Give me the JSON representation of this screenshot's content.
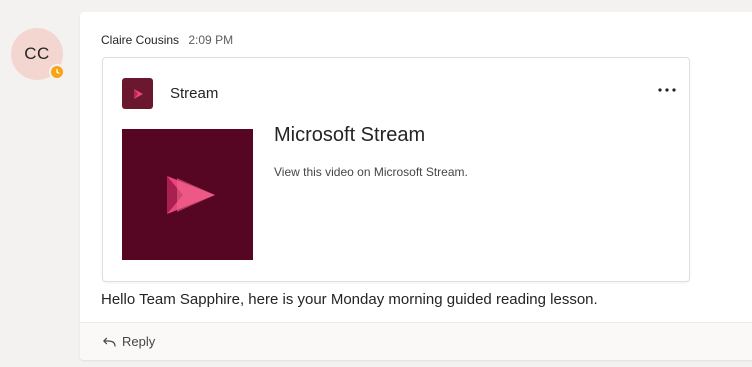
{
  "avatar": {
    "initials": "CC",
    "presence_status": "away",
    "presence_color": "#f8a415"
  },
  "message": {
    "author": "Claire Cousins",
    "time": "2:09 PM",
    "body": "Hello Team Sapphire, here is your Monday morning guided reading lesson."
  },
  "card": {
    "app_name": "Stream",
    "more_label": "•••",
    "title": "Microsoft Stream",
    "description": "View this video on Microsoft Stream.",
    "app_icon": "stream-play-icon",
    "brand_color": "#560622",
    "accent_color": "#e8467c"
  },
  "reply": {
    "label": "Reply",
    "icon": "reply-arrow-icon"
  }
}
